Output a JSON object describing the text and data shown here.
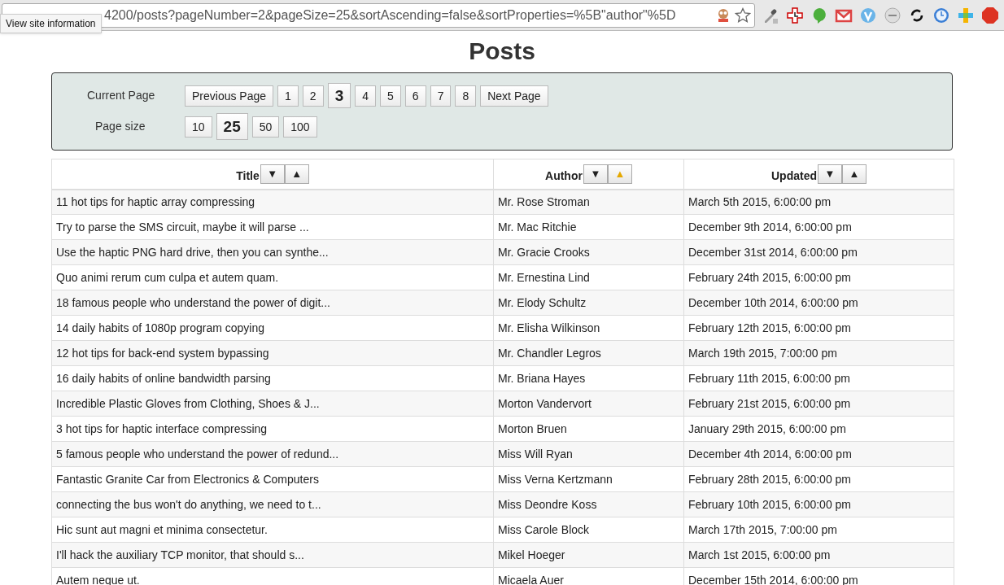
{
  "browser": {
    "url": "4200/posts?pageNumber=2&pageSize=25&sortAscending=false&sortProperties=%5B\"author\"%5D",
    "tooltip": "View site information"
  },
  "page_title": "Posts",
  "pagination": {
    "current_page_label": "Current Page",
    "prev_label": "Previous Page",
    "next_label": "Next Page",
    "pages": [
      {
        "label": "1",
        "selected": false
      },
      {
        "label": "2",
        "selected": false
      },
      {
        "label": "3",
        "selected": true
      },
      {
        "label": "4",
        "selected": false
      },
      {
        "label": "5",
        "selected": false
      },
      {
        "label": "6",
        "selected": false
      },
      {
        "label": "7",
        "selected": false
      },
      {
        "label": "8",
        "selected": false
      }
    ],
    "page_size_label": "Page size",
    "sizes": [
      {
        "label": "10",
        "selected": false
      },
      {
        "label": "25",
        "selected": true
      },
      {
        "label": "50",
        "selected": false
      },
      {
        "label": "100",
        "selected": false
      }
    ]
  },
  "table": {
    "columns": [
      {
        "label": "Title",
        "sort_buttons": [
          {
            "glyph": "▼",
            "selected": false
          },
          {
            "glyph": "▲",
            "selected": false
          }
        ]
      },
      {
        "label": "Author",
        "sort_buttons": [
          {
            "glyph": "▼",
            "selected": false
          },
          {
            "glyph": "▲",
            "selected": true
          }
        ]
      },
      {
        "label": "Updated",
        "sort_buttons": [
          {
            "glyph": "▼",
            "selected": false
          },
          {
            "glyph": "▲",
            "selected": false
          }
        ]
      }
    ],
    "rows": [
      [
        "11 hot tips for haptic array compressing",
        "Mr. Rose Stroman",
        "March 5th 2015, 6:00:00 pm"
      ],
      [
        "Try to parse the SMS circuit, maybe it will parse ...",
        "Mr. Mac Ritchie",
        "December 9th 2014, 6:00:00 pm"
      ],
      [
        "Use the haptic PNG hard drive, then you can synthe...",
        "Mr. Gracie Crooks",
        "December 31st 2014, 6:00:00 pm"
      ],
      [
        "Quo animi rerum cum culpa et autem quam.",
        "Mr. Ernestina Lind",
        "February 24th 2015, 6:00:00 pm"
      ],
      [
        "18 famous people who understand the power of digit...",
        "Mr. Elody Schultz",
        "December 10th 2014, 6:00:00 pm"
      ],
      [
        "14 daily habits of 1080p program copying",
        "Mr. Elisha Wilkinson",
        "February 12th 2015, 6:00:00 pm"
      ],
      [
        "12 hot tips for back-end system bypassing",
        "Mr. Chandler Legros",
        "March 19th 2015, 7:00:00 pm"
      ],
      [
        "16 daily habits of online bandwidth parsing",
        "Mr. Briana Hayes",
        "February 11th 2015, 6:00:00 pm"
      ],
      [
        "Incredible Plastic Gloves from Clothing, Shoes & J...",
        "Morton Vandervort",
        "February 21st 2015, 6:00:00 pm"
      ],
      [
        "3 hot tips for haptic interface compressing",
        "Morton Bruen",
        "January 29th 2015, 6:00:00 pm"
      ],
      [
        "5 famous people who understand the power of redund...",
        "Miss Will Ryan",
        "December 4th 2014, 6:00:00 pm"
      ],
      [
        "Fantastic Granite Car from Electronics & Computers",
        "Miss Verna Kertzmann",
        "February 28th 2015, 6:00:00 pm"
      ],
      [
        "connecting the bus won't do anything, we need to t...",
        "Miss Deondre Koss",
        "February 10th 2015, 6:00:00 pm"
      ],
      [
        "Hic sunt aut magni et minima consectetur.",
        "Miss Carole Block",
        "March 17th 2015, 7:00:00 pm"
      ],
      [
        "I'll hack the auxiliary TCP monitor, that should s...",
        "Mikel Hoeger",
        "March 1st 2015, 6:00:00 pm"
      ],
      [
        "Autem neque ut.",
        "Micaela Auer",
        "December 15th 2014, 6:00:00 pm"
      ]
    ]
  }
}
